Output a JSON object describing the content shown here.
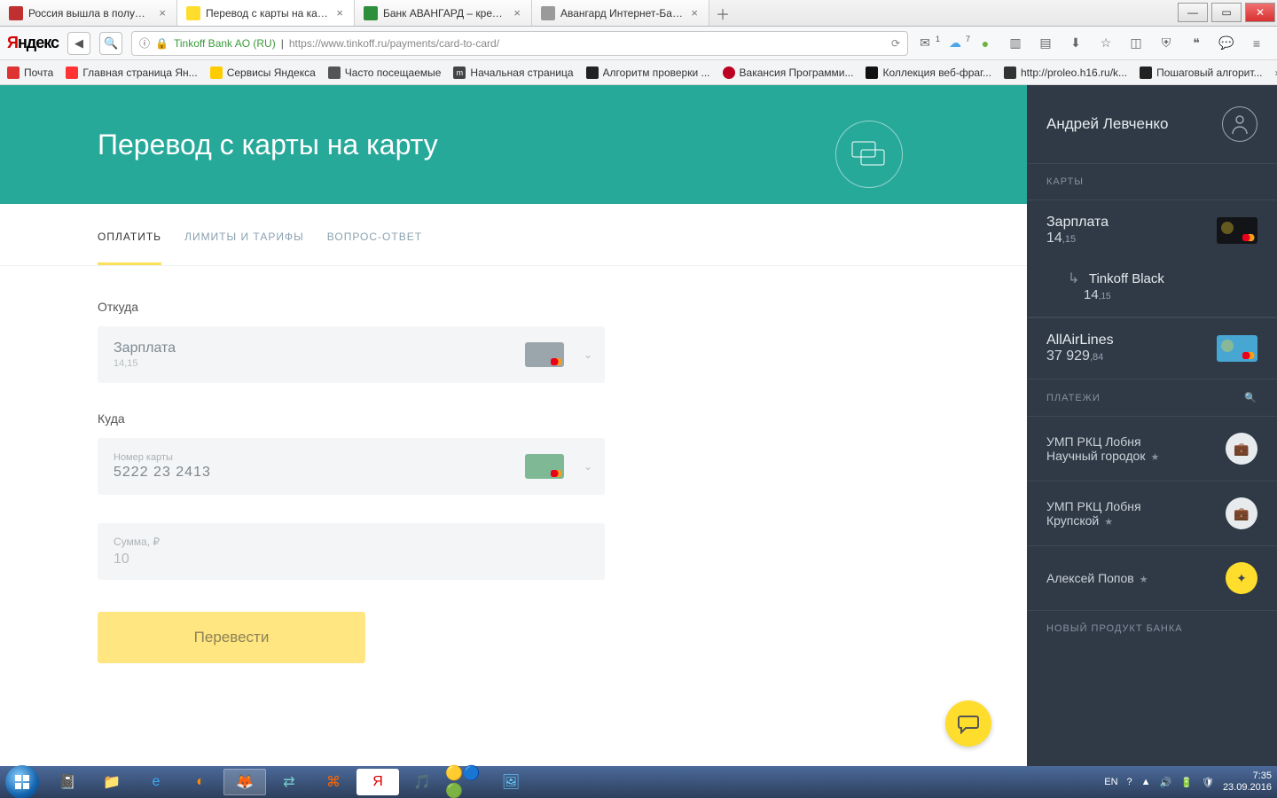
{
  "browser": {
    "tabs": [
      {
        "title": "Россия вышла в полуфин...",
        "favColor": "#c03030"
      },
      {
        "title": "Перевод с карты на карту",
        "favColor": "#ffdd2d",
        "active": true
      },
      {
        "title": "Банк АВАНГАРД – кредит...",
        "favColor": "#2d8f3c"
      },
      {
        "title": "Авангард Интернет-Банк для ...",
        "favColor": "#9a9a9a"
      }
    ],
    "identity": "Tinkoff Bank AO (RU)",
    "url": "https://www.tinkoff.ru/payments/card-to-card/",
    "mail_badge": "1",
    "weather_badge": "7",
    "toolicons": [
      "mail",
      "weather",
      "circle",
      "sheet",
      "book",
      "down",
      "star",
      "sidebar",
      "shield",
      "quote",
      "chat",
      "menu"
    ]
  },
  "bookmarks": [
    {
      "label": "Почта",
      "fav": "#d33"
    },
    {
      "label": "Главная страница Ян...",
      "fav": "#f33"
    },
    {
      "label": "Сервисы Яндекса",
      "fav": "#ffcc00"
    },
    {
      "label": "Часто посещаемые",
      "fav": "#555"
    },
    {
      "label": "Начальная страница",
      "fav": "#444"
    },
    {
      "label": "Алгоритм проверки ...",
      "fav": "#222"
    },
    {
      "label": "Вакансия Программи...",
      "fav": "#b02"
    },
    {
      "label": "Коллекция веб-фраг...",
      "fav": "#111"
    },
    {
      "label": "http://proleo.h16.ru/k...",
      "fav": "#333"
    },
    {
      "label": "Пошаговый алгорит...",
      "fav": "#222"
    }
  ],
  "teal_title": "Перевод с карты на карту",
  "page_tabs": {
    "pay": "ОПЛАТИТЬ",
    "limits": "ЛИМИТЫ И ТАРИФЫ",
    "faq": "ВОПРОС-ОТВЕТ"
  },
  "form": {
    "from_label": "Откуда",
    "from_name": "Зарплата",
    "from_bal": "14",
    "from_bal_sm": ",15",
    "to_label": "Куда",
    "card_label": "Номер карты",
    "card_value": "5222 23        2413",
    "sum_placeholder": "Сумма, ₽",
    "sum_value": "10",
    "submit": "Перевести"
  },
  "sidebar": {
    "user": "Андрей Левченко",
    "cards_label": "КАРТЫ",
    "cards": [
      {
        "name": "Зарплата",
        "bal": "14",
        "bal_sm": ",15",
        "mini": "black"
      }
    ],
    "sub": {
      "name": "Tinkoff Black",
      "bal": "14",
      "bal_sm": ",15"
    },
    "card2": {
      "name": "AllAirLines",
      "bal": "37 929",
      "bal_sm": ",84",
      "mini": "blue"
    },
    "pay_label": "ПЛАТЕЖИ",
    "pay_items": [
      {
        "l1": "УМП РКЦ Лобня",
        "l2": "Научный городок",
        "icon": "case"
      },
      {
        "l1": "УМП РКЦ Лобня",
        "l2": "Крупской",
        "icon": "case"
      },
      {
        "l1": "Алексей Попов",
        "l2": "",
        "icon": "y"
      }
    ],
    "new_prod": "НОВЫЙ ПРОДУКТ БАНКА"
  },
  "tray": {
    "lang": "EN",
    "time": "7:35",
    "date": "23.09.2016"
  }
}
